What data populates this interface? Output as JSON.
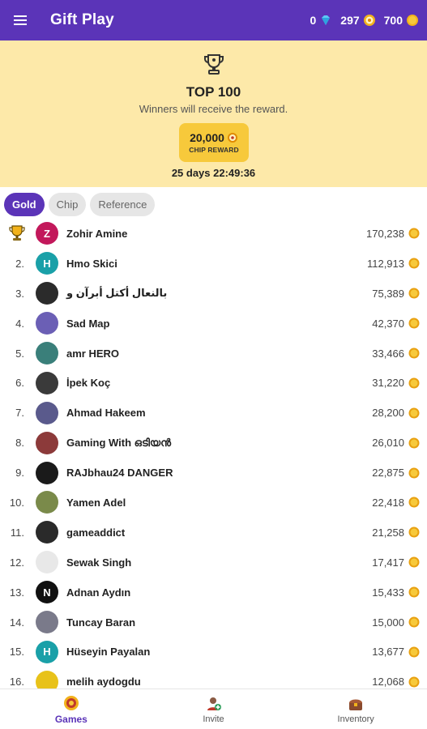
{
  "header": {
    "title": "Gift Play",
    "diamonds": "0",
    "chips": "297",
    "gold": "700",
    "menu_icon": "hamburger-icon"
  },
  "banner": {
    "title": "TOP 100",
    "subtitle": "Winners will receive the reward.",
    "reward_amount": "20,000",
    "reward_label": "CHIP REWARD",
    "countdown": "25 days 22:49:36"
  },
  "tabs": [
    {
      "label": "Gold",
      "active": true
    },
    {
      "label": "Chip",
      "active": false
    },
    {
      "label": "Reference",
      "active": false
    }
  ],
  "leaderboard": [
    {
      "rank": "",
      "name": "Zohir Amine",
      "score": "170,238",
      "initial": "Z",
      "color": "#c2185b"
    },
    {
      "rank": "2.",
      "name": "Hmo Skici",
      "score": "112,913",
      "initial": "H",
      "color": "#1aa0a8"
    },
    {
      "rank": "3.",
      "name": "بالنعال أكتل أبرآن و",
      "score": "75,389",
      "initial": "",
      "color": "#2b2b2b"
    },
    {
      "rank": "4.",
      "name": "Sad Map",
      "score": "42,370",
      "initial": "",
      "color": "#6b5fb5"
    },
    {
      "rank": "5.",
      "name": "amr HERO",
      "score": "33,466",
      "initial": "",
      "color": "#3a7f7a"
    },
    {
      "rank": "6.",
      "name": "İpek Koç",
      "score": "31,220",
      "initial": "",
      "color": "#3a3a3a"
    },
    {
      "rank": "7.",
      "name": "Ahmad Hakeem",
      "score": "28,200",
      "initial": "",
      "color": "#5a5a8c"
    },
    {
      "rank": "8.",
      "name": "Gaming With ഒടിയൻ",
      "score": "26,010",
      "initial": "",
      "color": "#8c3a3a"
    },
    {
      "rank": "9.",
      "name": "RAJbhau24 DANGER",
      "score": "22,875",
      "initial": "",
      "color": "#1a1a1a"
    },
    {
      "rank": "10.",
      "name": "Yamen Adel",
      "score": "22,418",
      "initial": "",
      "color": "#7a8a4a"
    },
    {
      "rank": "11.",
      "name": "gameaddict",
      "score": "21,258",
      "initial": "",
      "color": "#2a2a2a"
    },
    {
      "rank": "12.",
      "name": "Sewak Singh",
      "score": "17,417",
      "initial": "",
      "color": "#e8e8e8"
    },
    {
      "rank": "13.",
      "name": "Adnan Aydın",
      "score": "15,433",
      "initial": "N",
      "color": "#111111"
    },
    {
      "rank": "14.",
      "name": "Tuncay Baran",
      "score": "15,000",
      "initial": "",
      "color": "#7a7a8a"
    },
    {
      "rank": "15.",
      "name": "Hüseyin Payalan",
      "score": "13,677",
      "initial": "H",
      "color": "#1aa0a8"
    },
    {
      "rank": "16.",
      "name": "melih aydogdu",
      "score": "12,068",
      "initial": "",
      "color": "#e8c21a"
    }
  ],
  "bottom_nav": [
    {
      "label": "Games",
      "icon": "games-icon",
      "active": true
    },
    {
      "label": "Invite",
      "icon": "invite-icon",
      "active": false
    },
    {
      "label": "Inventory",
      "icon": "inventory-icon",
      "active": false
    }
  ],
  "colors": {
    "brand": "#5b34b8",
    "banner_bg": "#fde9a9",
    "reward_bg": "#f7c93b",
    "coin": "#f2b21b"
  }
}
